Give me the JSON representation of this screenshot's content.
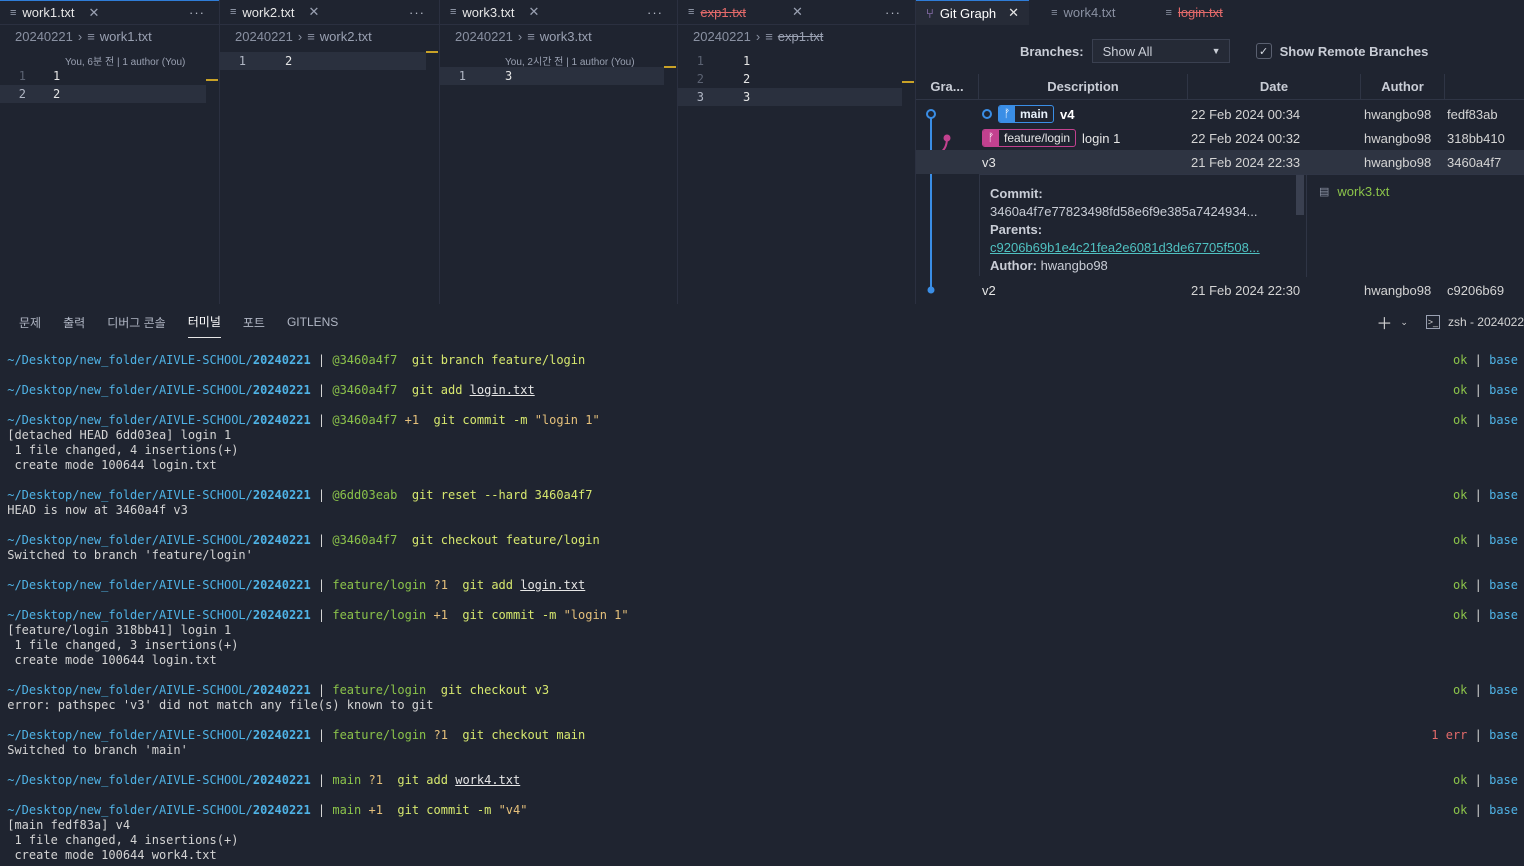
{
  "editors": [
    {
      "tab": "work1.txt",
      "tab_state": "normal",
      "crumb_folder": "20240221",
      "crumb_file": "work1.txt",
      "blame": "You, 6분 전 | 1 author (You)",
      "lines": [
        {
          "n": "1",
          "t": "1"
        },
        {
          "n": "2",
          "t": "2"
        }
      ]
    },
    {
      "tab": "work2.txt",
      "tab_state": "normal",
      "crumb_folder": "20240221",
      "crumb_file": "work2.txt",
      "blame": "",
      "lines": [
        {
          "n": "1",
          "t": "2"
        }
      ]
    },
    {
      "tab": "work3.txt",
      "tab_state": "normal",
      "crumb_folder": "20240221",
      "crumb_file": "work3.txt",
      "blame": "You, 2시간 전 | 1 author (You)",
      "lines": [
        {
          "n": "1",
          "t": "3"
        }
      ]
    },
    {
      "tab": "exp1.txt",
      "tab_state": "deleted",
      "crumb_folder": "20240221",
      "crumb_file": "exp1.txt",
      "blame": "",
      "lines": [
        {
          "n": "1",
          "t": "1"
        },
        {
          "n": "2",
          "t": "2"
        },
        {
          "n": "3",
          "t": "3"
        }
      ]
    }
  ],
  "git_graph": {
    "tabs": [
      {
        "label": "Git Graph",
        "state": "active"
      },
      {
        "label": "work4.txt",
        "state": "dim"
      },
      {
        "label": "login.txt",
        "state": "deleted"
      }
    ],
    "branches_label": "Branches:",
    "branches_value": "Show All",
    "show_remote_label": "Show Remote Branches",
    "show_remote_checked": true,
    "columns": [
      "Gra...",
      "Description",
      "Date",
      "Author"
    ],
    "rows": [
      {
        "badge": "main",
        "badge_type": "main",
        "desc": "v4",
        "date": "22 Feb 2024 00:34",
        "author": "hwangbo98",
        "hash": "fedf83ab"
      },
      {
        "badge": "feature/login",
        "badge_type": "feature",
        "desc": "login 1",
        "date": "22 Feb 2024 00:32",
        "author": "hwangbo98",
        "hash": "318bb410"
      },
      {
        "badge": "",
        "badge_type": "",
        "desc": "v3",
        "date": "21 Feb 2024 22:33",
        "author": "hwangbo98",
        "hash": "3460a4f7"
      },
      {
        "badge": "",
        "badge_type": "",
        "desc": "v2",
        "date": "21 Feb 2024 22:30",
        "author": "hwangbo98",
        "hash": "c9206b69"
      }
    ],
    "detail": {
      "commit_label": "Commit:",
      "commit_value": "3460a4f7e77823498fd58e6f9e385a7424934...",
      "parents_label": "Parents:",
      "parents_value": "c9206b69b1e4c21fea2e6081d3de67705f508...",
      "author_label": "Author:",
      "author_value": "hwangbo98",
      "file": "work3.txt"
    }
  },
  "panel": {
    "tabs": [
      "문제",
      "출력",
      "디버그 콘솔",
      "터미널",
      "포트",
      "GITLENS"
    ],
    "active_tab": "터미널",
    "terminal_name": "zsh - 2024022"
  },
  "terminal": {
    "path": "~/Desktop/new_folder/AIVLE-SCHOOL/",
    "dir": "20240221",
    "ok": "ok",
    "err": "1 err",
    "base": "base",
    "prompts": [
      {
        "ctx": "@3460a4f7",
        "status": "",
        "cmd": "git branch feature/login",
        "result": "ok"
      },
      {
        "ctx": "@3460a4f7",
        "status": "",
        "cmd": "git add",
        "arg_ul": "login.txt",
        "result": "ok"
      },
      {
        "ctx": "@3460a4f7",
        "status": "+1",
        "cmd": "git commit -m",
        "arg_str": "\"login 1\"",
        "result": "ok"
      },
      {
        "ctx": "@6dd03eab",
        "status": "",
        "cmd": "git reset --hard 3460a4f7",
        "result": "ok"
      },
      {
        "ctx": "@3460a4f7",
        "status": "",
        "cmd": "git checkout feature/login",
        "result": "ok"
      },
      {
        "ctx": "feature/login",
        "status": "?1",
        "cmd": "git add",
        "arg_ul": "login.txt",
        "result": "ok"
      },
      {
        "ctx": "feature/login",
        "status": "+1",
        "cmd": "git commit -m",
        "arg_str": "\"login 1\"",
        "result": "ok"
      },
      {
        "ctx": "feature/login",
        "status": "",
        "cmd": "git checkout v3",
        "result": "ok"
      },
      {
        "ctx": "feature/login",
        "status": "?1",
        "cmd": "git checkout main",
        "result": "err"
      },
      {
        "ctx": "main",
        "status": "?1",
        "cmd": "git add",
        "arg_ul": "work4.txt",
        "result": "ok"
      },
      {
        "ctx": "main",
        "status": "+1",
        "cmd": "git commit -m",
        "arg_str": "\"v4\"",
        "result": "ok"
      }
    ],
    "outputs": [
      [
        "[detached HEAD 6dd03ea] login 1",
        " 1 file changed, 4 insertions(+)",
        " create mode 100644 login.txt"
      ],
      [
        "HEAD is now at 3460a4f v3"
      ],
      [
        "Switched to branch 'feature/login'"
      ],
      [
        "[feature/login 318bb41] login 1",
        " 1 file changed, 3 insertions(+)",
        " create mode 100644 login.txt"
      ],
      [
        "error: pathspec 'v3' did not match any file(s) known to git"
      ],
      [
        "Switched to branch 'main'"
      ],
      [
        "[main fedf83a] v4",
        " 1 file changed, 4 insertions(+)",
        " create mode 100644 work4.txt"
      ]
    ]
  }
}
